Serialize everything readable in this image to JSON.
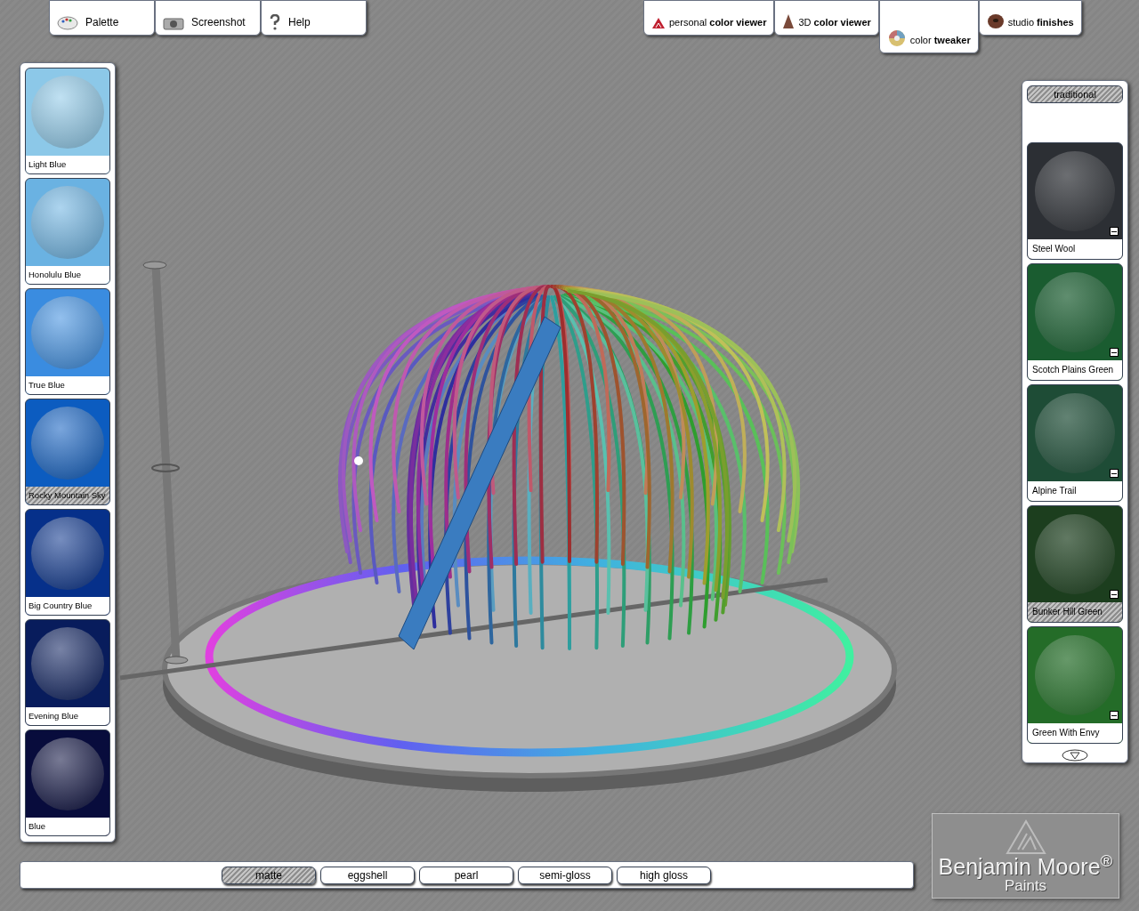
{
  "top_tabs_left": [
    {
      "kind": "palette",
      "label": "Palette"
    },
    {
      "kind": "camera",
      "label": "Screenshot"
    },
    {
      "kind": "help",
      "label": "Help"
    }
  ],
  "top_tabs_right": [
    {
      "kind": "triangle",
      "label": "personal **color viewer**",
      "selected": false
    },
    {
      "kind": "cone",
      "label": "3D **color viewer**",
      "selected": false
    },
    {
      "kind": "wheel",
      "label": "color **tweaker**",
      "selected": true
    },
    {
      "kind": "donut",
      "label": "studio **finishes**",
      "selected": false
    }
  ],
  "left_swatches": [
    {
      "name": "Light Blue",
      "color": "#8cc8e8",
      "selected": false
    },
    {
      "name": "Honolulu Blue",
      "color": "#6ab2e2",
      "selected": false
    },
    {
      "name": "True Blue",
      "color": "#3a8ce0",
      "selected": false
    },
    {
      "name": "Rocky Mountain Sky",
      "color": "#0c5cc0",
      "selected": true
    },
    {
      "name": "Big Country Blue",
      "color": "#06308a",
      "selected": false
    },
    {
      "name": "Evening Blue",
      "color": "#081c5c",
      "selected": false
    },
    {
      "name": "Blue",
      "color": "#080c3c",
      "selected": false
    }
  ],
  "right_panel": {
    "category": {
      "label": "traditional",
      "selected": true
    },
    "swatches": [
      {
        "name": "Steel Wool",
        "color": "#2c2f34",
        "selected": false
      },
      {
        "name": "Scotch Plains Green",
        "color": "#1a5c30",
        "selected": false
      },
      {
        "name": "Alpine Trail",
        "color": "#1e4c36",
        "selected": false
      },
      {
        "name": "Bunker Hill Green",
        "color": "#1c3e1e",
        "selected": true
      },
      {
        "name": "Green With Envy",
        "color": "#246c28",
        "selected": false
      }
    ]
  },
  "finishes": [
    {
      "label": "matte",
      "selected": true
    },
    {
      "label": "eggshell",
      "selected": false
    },
    {
      "label": "pearl",
      "selected": false
    },
    {
      "label": "semi-gloss",
      "selected": false
    },
    {
      "label": "high gloss",
      "selected": false
    }
  ],
  "logo": {
    "name": "Benjamin Moore$^{®}$",
    "sub": "Paints"
  }
}
